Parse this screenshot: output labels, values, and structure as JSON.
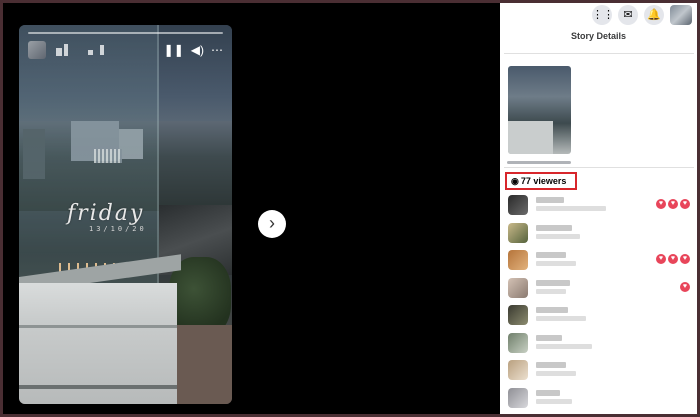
{
  "story": {
    "caption": "friday",
    "caption_date": "13/10/20",
    "controls": {
      "pause": "❚❚",
      "volume": "◀)",
      "more": "⋯"
    }
  },
  "navigation": {
    "next_icon": "chevron-right-icon",
    "next_glyph": "›"
  },
  "topbar": {
    "icons": [
      {
        "name": "menu-grid-icon",
        "glyph": "⋮⋮"
      },
      {
        "name": "messenger-icon",
        "glyph": "✉"
      },
      {
        "name": "notifications-bell-icon",
        "glyph": "🔔"
      }
    ]
  },
  "panel": {
    "title": "Story Details",
    "viewers_count_label": "77 viewers",
    "viewers_icon": "eye-icon",
    "viewers": [
      {
        "reactions": 3
      },
      {
        "reactions": 0
      },
      {
        "reactions": 3
      },
      {
        "reactions": 1
      },
      {
        "reactions": 0
      },
      {
        "reactions": 0
      },
      {
        "reactions": 0
      },
      {
        "reactions": 0
      }
    ]
  },
  "colors": {
    "highlight_border": "#d7262b",
    "reaction_heart": "#e8455a",
    "panel_bg": "#ffffff",
    "viewer_bg": "#000000"
  }
}
